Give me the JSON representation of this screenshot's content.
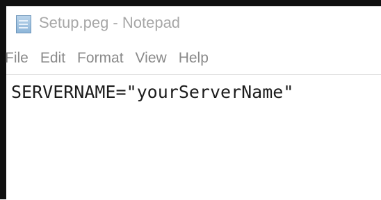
{
  "window": {
    "title": "Setup.peg - Notepad",
    "icon": "notepad-icon"
  },
  "menu": {
    "items": [
      {
        "label": "File"
      },
      {
        "label": "Edit"
      },
      {
        "label": "Format"
      },
      {
        "label": "View"
      },
      {
        "label": "Help"
      }
    ]
  },
  "editor": {
    "content": "SERVERNAME=\"yourServerName\""
  },
  "colors": {
    "frame": "#101010",
    "title_text": "#a7a7a7",
    "menu_text": "#8a8a8a",
    "editor_text": "#1c1c1c",
    "icon_blue": "#8eb6d9"
  }
}
